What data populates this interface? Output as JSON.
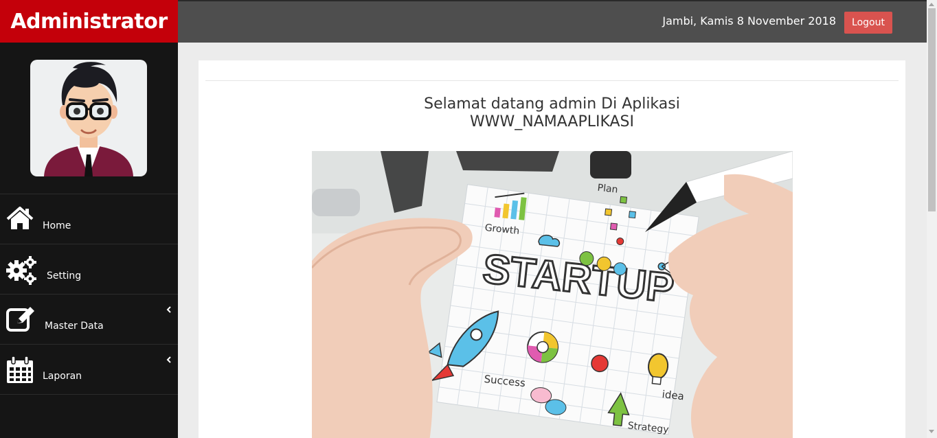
{
  "header": {
    "brand": "Administrator",
    "date": "Jambi, Kamis 8 November 2018",
    "logout_label": "Logout"
  },
  "sidebar": {
    "items": [
      {
        "label": "Home",
        "icon": "home-icon",
        "has_submenu": false
      },
      {
        "label": "Setting",
        "icon": "gears-icon",
        "has_submenu": false
      },
      {
        "label": "Master Data",
        "icon": "edit-icon",
        "has_submenu": true
      },
      {
        "label": "Laporan",
        "icon": "calendar-icon",
        "has_submenu": true
      }
    ]
  },
  "main": {
    "welcome_line1": "Selamat datang admin Di Aplikasi",
    "welcome_line2": "WWW_NAMAAPLIKASI",
    "hero_word": "STARTUP",
    "hero_labels": [
      "Plan",
      "Growth",
      "Success",
      "idea",
      "Strategy"
    ]
  },
  "colors": {
    "brand": "#c4000a",
    "sidebar": "#151515",
    "topbar": "#4e4e4e",
    "logout": "#d9534f"
  }
}
